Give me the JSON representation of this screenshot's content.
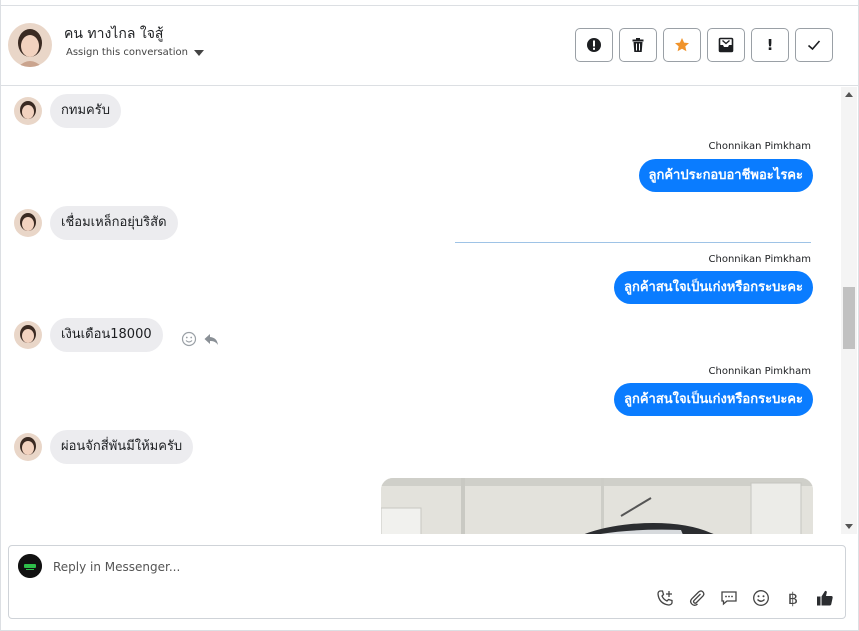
{
  "header": {
    "contact_name": "คน ทางไกล ใจสู้",
    "assign_label": "Assign this conversation",
    "actions": [
      {
        "icon": "alert-circle-icon",
        "glyph": "!"
      },
      {
        "icon": "trash-icon"
      },
      {
        "icon": "star-icon"
      },
      {
        "icon": "archive-icon"
      },
      {
        "icon": "exclamation-icon",
        "glyph": "!"
      },
      {
        "icon": "check-icon"
      }
    ]
  },
  "messages": [
    {
      "direction": "in",
      "text": "กทมครับ"
    },
    {
      "direction": "out",
      "sender": "Chonnikan Pimkham",
      "text": "ลูกค้าประกอบอาชีพอะไรคะ"
    },
    {
      "direction": "in",
      "text": "เชื่อมเหล็กอยุ่บริสัด"
    },
    {
      "direction": "out",
      "sender": "Chonnikan Pimkham",
      "text": "ลูกค้าสนใจเป็นเก่งหรือกระบะคะ"
    },
    {
      "direction": "in",
      "text": "เงินเดือน18000"
    },
    {
      "direction": "out",
      "sender": "Chonnikan Pimkham",
      "text": "ลูกค้าสนใจเป็นเก่งหรือกระบะคะ"
    },
    {
      "direction": "in",
      "text": "ผ่อนจักสี่พันมีให้มครับ"
    }
  ],
  "composer": {
    "placeholder": "Reply in Messenger...",
    "tools": [
      "phone-add-icon",
      "paperclip-icon",
      "saved-reply-icon",
      "emoji-icon",
      "baht-icon",
      "thumbs-up-icon"
    ],
    "baht_glyph": "฿"
  },
  "colors": {
    "outgoing_bubble": "#0a7cff",
    "incoming_bubble": "#ececef",
    "star": "#f0932b"
  }
}
